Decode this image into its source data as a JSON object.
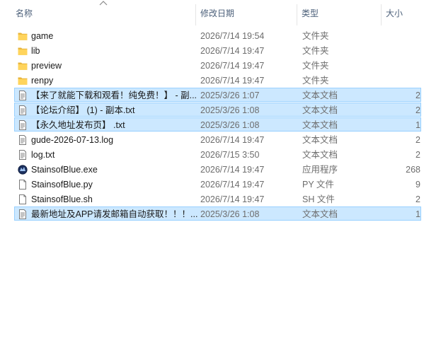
{
  "columns": {
    "name": "名称",
    "date": "修改日期",
    "type": "类型",
    "size": "大小"
  },
  "rows": [
    {
      "name": "game",
      "date": "2026/7/14 19:54",
      "type": "文件夹",
      "size": "",
      "icon": "folder-icon",
      "selected": false
    },
    {
      "name": "lib",
      "date": "2026/7/14 19:47",
      "type": "文件夹",
      "size": "",
      "icon": "folder-icon",
      "selected": false
    },
    {
      "name": "preview",
      "date": "2026/7/14 19:47",
      "type": "文件夹",
      "size": "",
      "icon": "folder-icon",
      "selected": false
    },
    {
      "name": "renpy",
      "date": "2026/7/14 19:47",
      "type": "文件夹",
      "size": "",
      "icon": "folder-icon",
      "selected": false
    },
    {
      "name": "【来了就能下载和观看！纯免费！】 - 副...",
      "date": "2025/3/26 1:07",
      "type": "文本文档",
      "size": "2",
      "icon": "text-file-icon",
      "selected": true
    },
    {
      "name": "【论坛介绍】 (1) - 副本.txt",
      "date": "2025/3/26 1:08",
      "type": "文本文档",
      "size": "2",
      "icon": "text-file-icon",
      "selected": true
    },
    {
      "name": "【永久地址发布页】 .txt",
      "date": "2025/3/26 1:08",
      "type": "文本文档",
      "size": "1",
      "icon": "text-file-icon",
      "selected": true
    },
    {
      "name": "gude-2026-07-13.log",
      "date": "2026/7/14 19:47",
      "type": "文本文档",
      "size": "2",
      "icon": "text-file-icon",
      "selected": false
    },
    {
      "name": "log.txt",
      "date": "2026/7/15 3:50",
      "type": "文本文档",
      "size": "2",
      "icon": "text-file-icon",
      "selected": false
    },
    {
      "name": "StainsofBlue.exe",
      "date": "2026/7/14 19:47",
      "type": "应用程序",
      "size": "268",
      "icon": "app-icon",
      "selected": false
    },
    {
      "name": "StainsofBlue.py",
      "date": "2026/7/14 19:47",
      "type": "PY 文件",
      "size": "9",
      "icon": "blank-file-icon",
      "selected": false
    },
    {
      "name": "StainsofBlue.sh",
      "date": "2026/7/14 19:47",
      "type": "SH 文件",
      "size": "2",
      "icon": "blank-file-icon",
      "selected": false
    },
    {
      "name": "最新地址及APP请发邮箱自动获取！！！...",
      "date": "2025/3/26 1:08",
      "type": "文本文档",
      "size": "1",
      "icon": "text-file-icon",
      "selected": true
    }
  ]
}
